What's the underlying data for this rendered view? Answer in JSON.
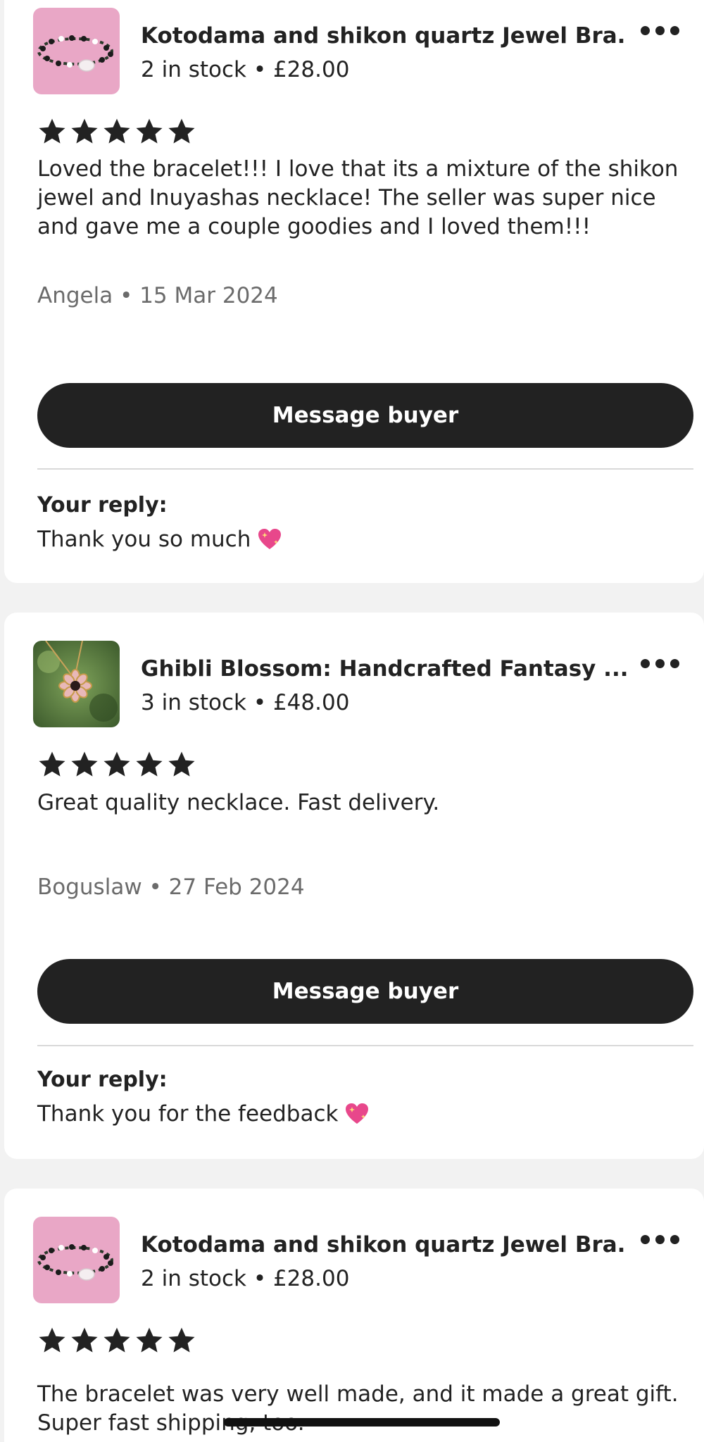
{
  "reviews": [
    {
      "product": {
        "title": "Kotodama and shikon quartz Jewel Bra...",
        "meta": "2 in stock • £28.00",
        "thumbnail_icon": "bracelet-thumbnail"
      },
      "rating": 5,
      "text": "Loved the bracelet!!! I love that its a mixture of the shikon jewel and Inuyashas necklace! The seller was super nice and gave me a couple goodies and I loved them!!!",
      "author_line": "Angela • 15 Mar 2024",
      "message_button_label": "Message buyer",
      "reply_label": "Your reply:",
      "reply_text": "Thank you so much",
      "reply_emoji": "sparkling-heart-icon"
    },
    {
      "product": {
        "title": "Ghibli Blossom: Handcrafted  Fantasy ...",
        "meta": "3 in stock • £48.00",
        "thumbnail_icon": "flower-necklace-thumbnail"
      },
      "rating": 5,
      "text": "Great quality necklace. Fast delivery.",
      "author_line": "Boguslaw • 27 Feb 2024",
      "message_button_label": "Message buyer",
      "reply_label": "Your reply:",
      "reply_text": "Thank you for the feedback",
      "reply_emoji": "sparkling-heart-icon"
    },
    {
      "product": {
        "title": "Kotodama and shikon quartz Jewel Bra...",
        "meta": "2 in stock • £28.00",
        "thumbnail_icon": "bracelet-thumbnail"
      },
      "rating": 5,
      "text": "The bracelet was very well made, and it made a great gift. Super fast shipping, too."
    }
  ],
  "colors": {
    "page_background": "#f2f2f2",
    "card_background": "#ffffff",
    "primary_button": "#222222",
    "muted_text": "#6b6b6b",
    "divider": "#d9d9d9",
    "heart": "#e8478b"
  }
}
